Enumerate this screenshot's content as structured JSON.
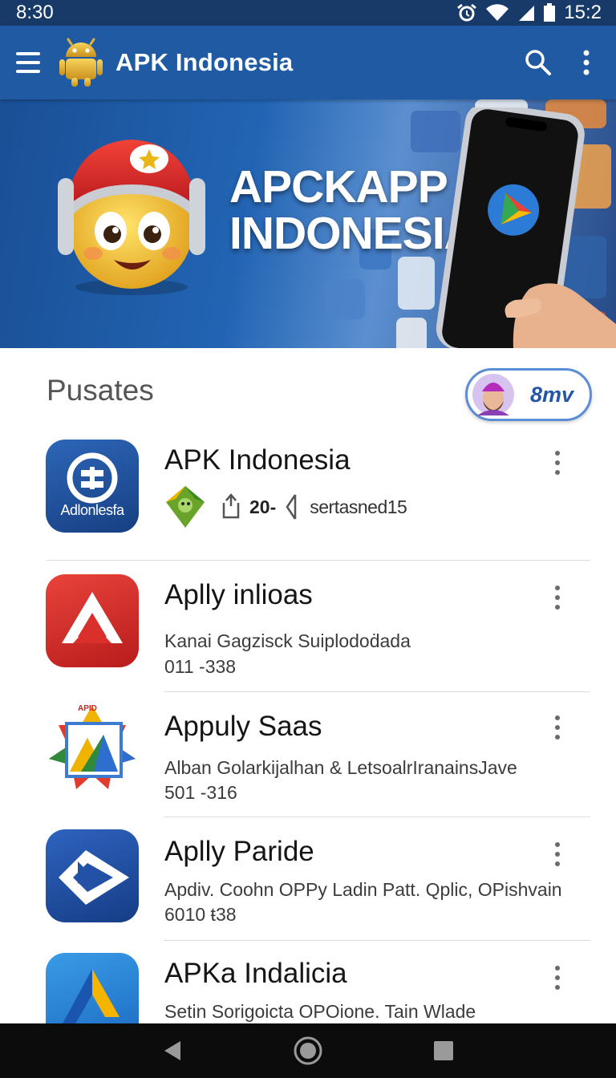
{
  "status_bar": {
    "time_left": "8:30",
    "time_right": "15:2",
    "icons": [
      "alarm-icon",
      "wifi-icon",
      "signal-icon",
      "battery-icon"
    ]
  },
  "app_bar": {
    "title": "APK Indonesia",
    "menu_icon": "hamburger-menu-icon",
    "logo_icon": "android-robot-logo",
    "search_icon": "search-icon",
    "overflow_icon": "more-vert-icon",
    "color": "#1f5aa3"
  },
  "banner": {
    "line1": "APCKAPP",
    "line2": "INDONESIA"
  },
  "section": {
    "title": "Pusates",
    "profile_button_label": "8mv"
  },
  "apps": [
    {
      "title": "APK Indonesia",
      "icon_label": "Adlonlesfa",
      "count": "20-",
      "meta_label": "sertasned15",
      "icon_color": "#21509a"
    },
    {
      "title": "Aplly inlioas",
      "subtitle": "Kanai Gagzisck Suiplodoḋada",
      "number": "011 -338",
      "icon_color": "#d9302c"
    },
    {
      "title": "Appuly Saas",
      "subtitle": "Alban Golarkijalhan & LetsoalrIranainsJave",
      "number": "501 -316",
      "icon_label": "APID"
    },
    {
      "title": "Aplly Paride",
      "subtitle": "Apdiv. Coohn OPPy Ladin Patt. Qplic, OPishvain",
      "number": "6010 ŧ38",
      "icon_color": "#2251a6"
    },
    {
      "title": "APKa Indalicia",
      "subtitle": "Setin Sorigoicta OPOione. Tain Wlade",
      "icon_color": "#2a83d6"
    }
  ],
  "nav_bar": {
    "back_icon": "back-triangle-icon",
    "home_icon": "home-circle-icon",
    "recents_icon": "recents-square-icon"
  }
}
